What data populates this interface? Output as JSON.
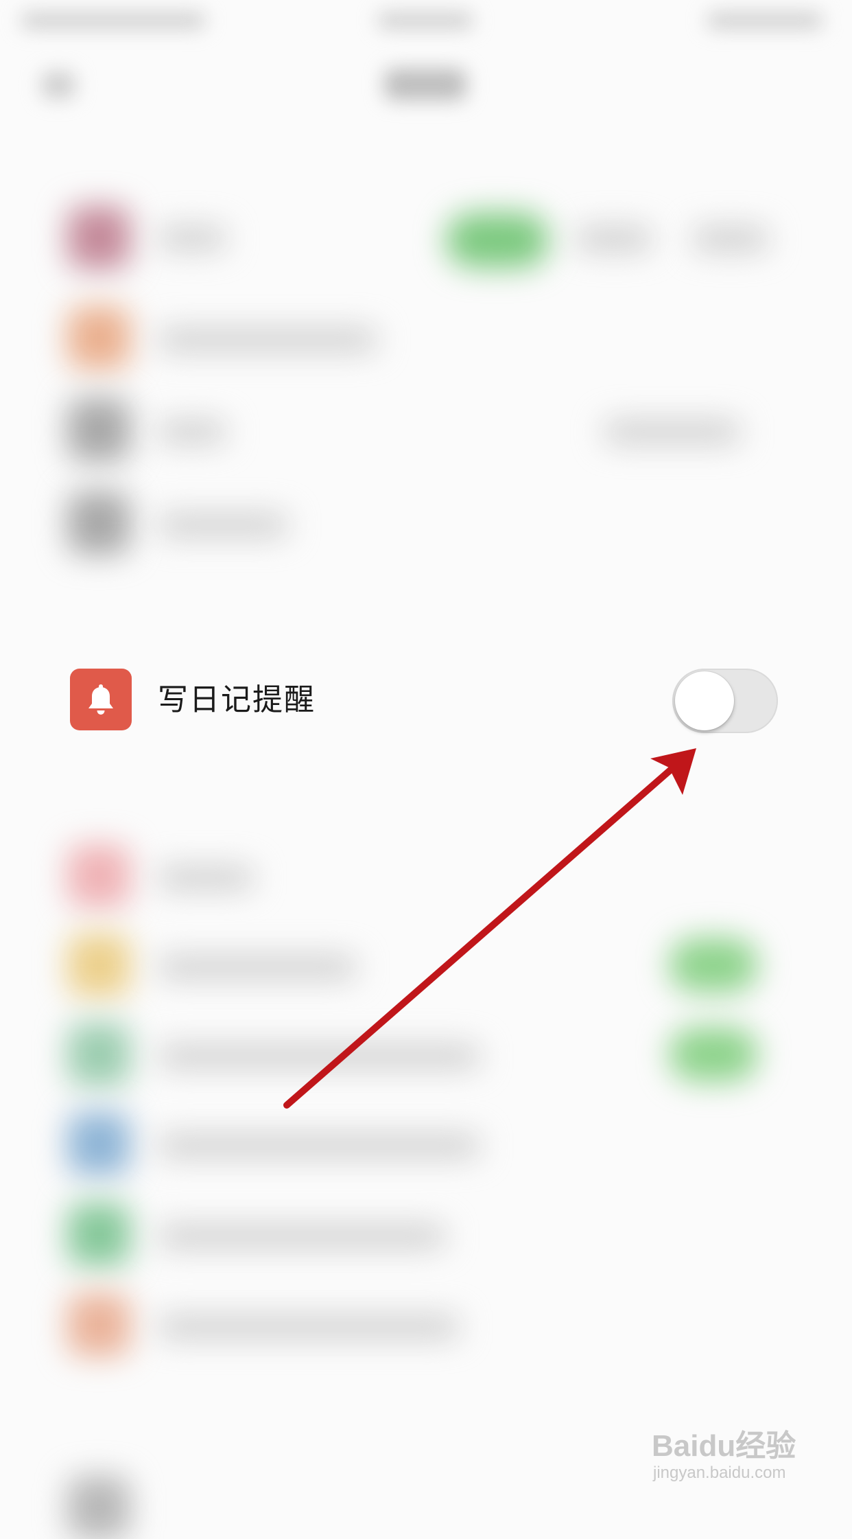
{
  "reminder": {
    "label": "写日记提醒",
    "toggle_on": false
  },
  "watermark": {
    "logo": "Baidu经验",
    "url": "jingyan.baidu.com"
  },
  "colors": {
    "bell_tile": "#e05a4a",
    "annotation_arrow": "#c0161a"
  },
  "icons": {
    "reminder": "bell-icon"
  }
}
